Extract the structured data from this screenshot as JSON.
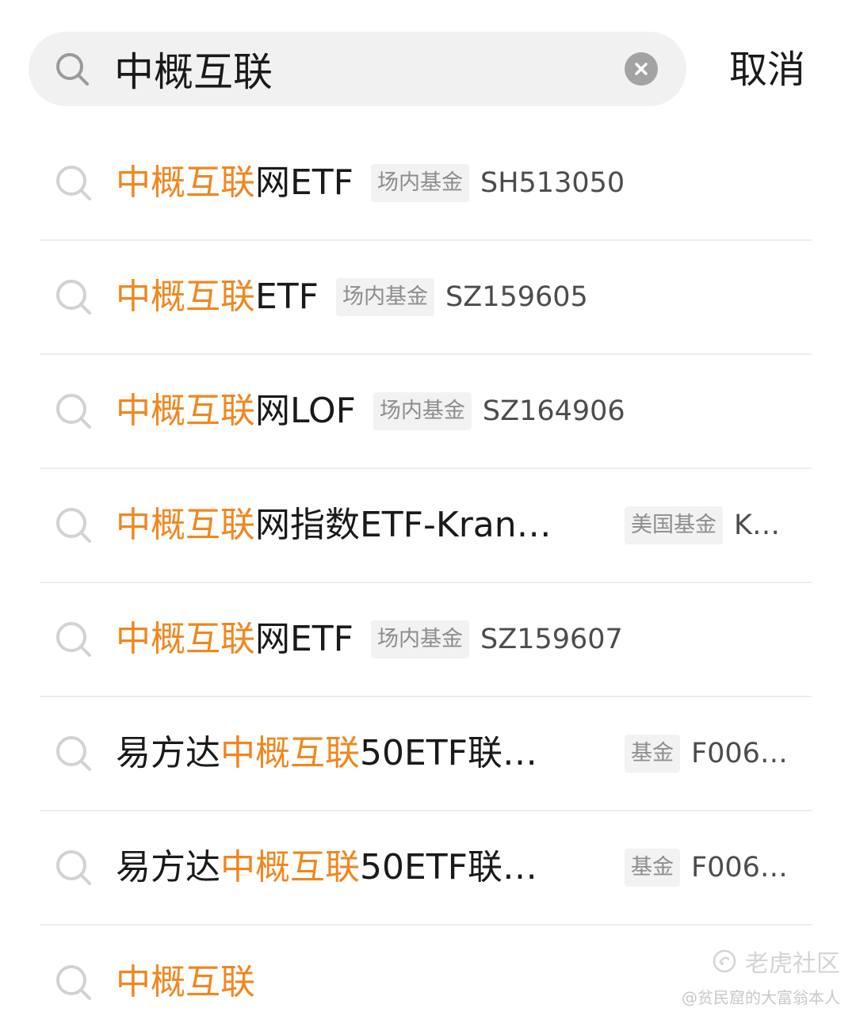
{
  "search": {
    "query": "中概互联",
    "cancel_label": "取消",
    "clear_icon": "clear-icon",
    "search_icon": "search-icon"
  },
  "suggestions": [
    {
      "name_parts": [
        {
          "t": "中概互联",
          "hl": true
        },
        {
          "t": "网ETF",
          "hl": false
        }
      ],
      "tag": "场内基金",
      "code": "SH513050"
    },
    {
      "name_parts": [
        {
          "t": "中概互联",
          "hl": true
        },
        {
          "t": "ETF",
          "hl": false
        }
      ],
      "tag": "场内基金",
      "code": "SZ159605"
    },
    {
      "name_parts": [
        {
          "t": "中概互联",
          "hl": true
        },
        {
          "t": "网LOF",
          "hl": false
        }
      ],
      "tag": "场内基金",
      "code": "SZ164906"
    },
    {
      "name_parts": [
        {
          "t": "中概互联",
          "hl": true
        },
        {
          "t": "网指数ETF-Kran…",
          "hl": false
        }
      ],
      "tag": "美国基金",
      "code": "K…"
    },
    {
      "name_parts": [
        {
          "t": "中概互联",
          "hl": true
        },
        {
          "t": "网ETF",
          "hl": false
        }
      ],
      "tag": "场内基金",
      "code": "SZ159607"
    },
    {
      "name_parts": [
        {
          "t": "易方达",
          "hl": false
        },
        {
          "t": "中概互联",
          "hl": true
        },
        {
          "t": "50ETF联…",
          "hl": false
        }
      ],
      "tag": "基金",
      "code": "F006…"
    },
    {
      "name_parts": [
        {
          "t": "易方达",
          "hl": false
        },
        {
          "t": "中概互联",
          "hl": true
        },
        {
          "t": "50ETF联…",
          "hl": false
        }
      ],
      "tag": "基金",
      "code": "F006…"
    },
    {
      "name_parts": [
        {
          "t": "中概互联",
          "hl": true
        }
      ],
      "tag": "",
      "code": ""
    }
  ],
  "watermark": {
    "brand": "老虎社区",
    "user": "@贫民窟的大富翁本人"
  },
  "colors": {
    "highlight": "#f0871f",
    "text": "#1a1a1a",
    "tag_bg": "#f2f2f2",
    "tag_text": "#8d8d8d",
    "code_text": "#4c4c4c",
    "search_bg": "#f1f1f1",
    "divider": "#ededed"
  }
}
